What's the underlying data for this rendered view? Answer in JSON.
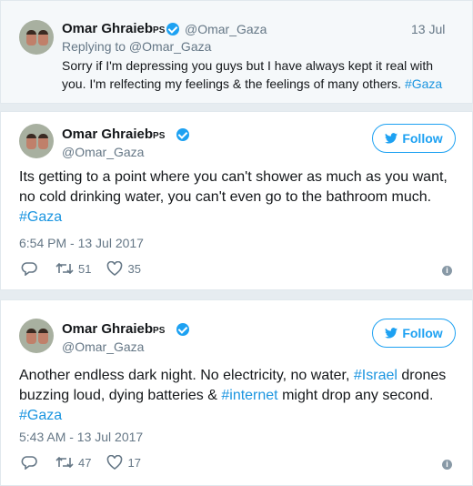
{
  "reply_tweet": {
    "author_name": "Omar Ghraieb",
    "author_suffix": "PS",
    "handle": "@Omar_Gaza",
    "date": "13 Jul",
    "replying_to": "Replying to @Omar_Gaza",
    "text_main": "Sorry if I'm depressing you guys but I have always kept it real with you. I'm relfecting my feelings & the feelings of many others. ",
    "hashtag": "#Gaza"
  },
  "tweets": [
    {
      "author_name": "Omar Ghraieb",
      "author_suffix": "PS",
      "handle": "@Omar_Gaza",
      "follow_label": "Follow",
      "text_main": "Its getting to a point where you can't shower as much as you want, no cold drinking water, you can't even go to the bathroom much.",
      "hashtag": "#Gaza",
      "timestamp": "6:54 PM - 13 Jul 2017",
      "retweets": "51",
      "likes": "35"
    },
    {
      "author_name": "Omar Ghraieb",
      "author_suffix": "PS",
      "handle": "@Omar_Gaza",
      "follow_label": "Follow",
      "text_part1": "Another endless dark night. No electricity, no water, ",
      "link1": "#Israel",
      "text_part2": " drones buzzing loud, dying batteries & ",
      "link2": "#internet",
      "text_part3": " might drop any second.",
      "hashtag": "#Gaza",
      "timestamp": "5:43 AM - 13 Jul 2017",
      "retweets": "47",
      "likes": "17"
    }
  ],
  "colors": {
    "accent": "#1da1f2",
    "link": "#1b95e0",
    "muted": "#657786"
  },
  "icons": [
    "reply-icon",
    "retweet-icon",
    "like-icon",
    "info-icon",
    "verified-badge-icon",
    "twitter-bird-icon"
  ]
}
